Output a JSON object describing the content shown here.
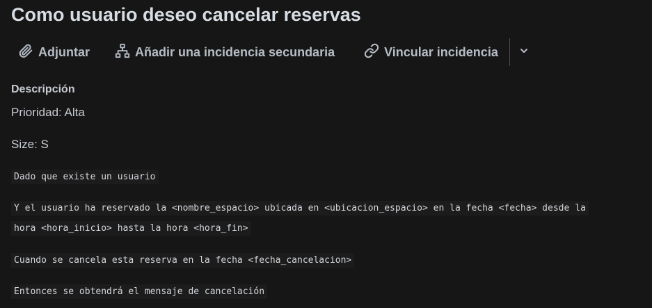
{
  "issue": {
    "title": "Como usuario deseo cancelar reservas"
  },
  "toolbar": {
    "attach_label": "Adjuntar",
    "add_child_label": "Añadir una incidencia secundaria",
    "link_label": "Vincular incidencia",
    "more_icon": "chevron-down-icon",
    "attach_icon": "paperclip-icon",
    "child_icon": "hierarchy-icon",
    "link_icon": "link-icon"
  },
  "description": {
    "label": "Descripción",
    "priority": "Prioridad: Alta",
    "size": "Size: S",
    "code_lines": [
      "Dado que existe un usuario",
      "Y el usuario ha reservado la <nombre_espacio> ubicada en <ubicacion_espacio> en la fecha <fecha> desde la",
      "hora <hora_inicio> hasta la hora <hora_fin>",
      "Cuando se cancela esta reserva en la fecha <fecha_cancelacion>",
      "Entonces se obtendrá el mensaje de cancelación"
    ]
  },
  "colors": {
    "background": "#161616",
    "text": "#c8ccd2",
    "toolbar_text": "#b7bdc6",
    "code_background": "#1c1c1c"
  }
}
